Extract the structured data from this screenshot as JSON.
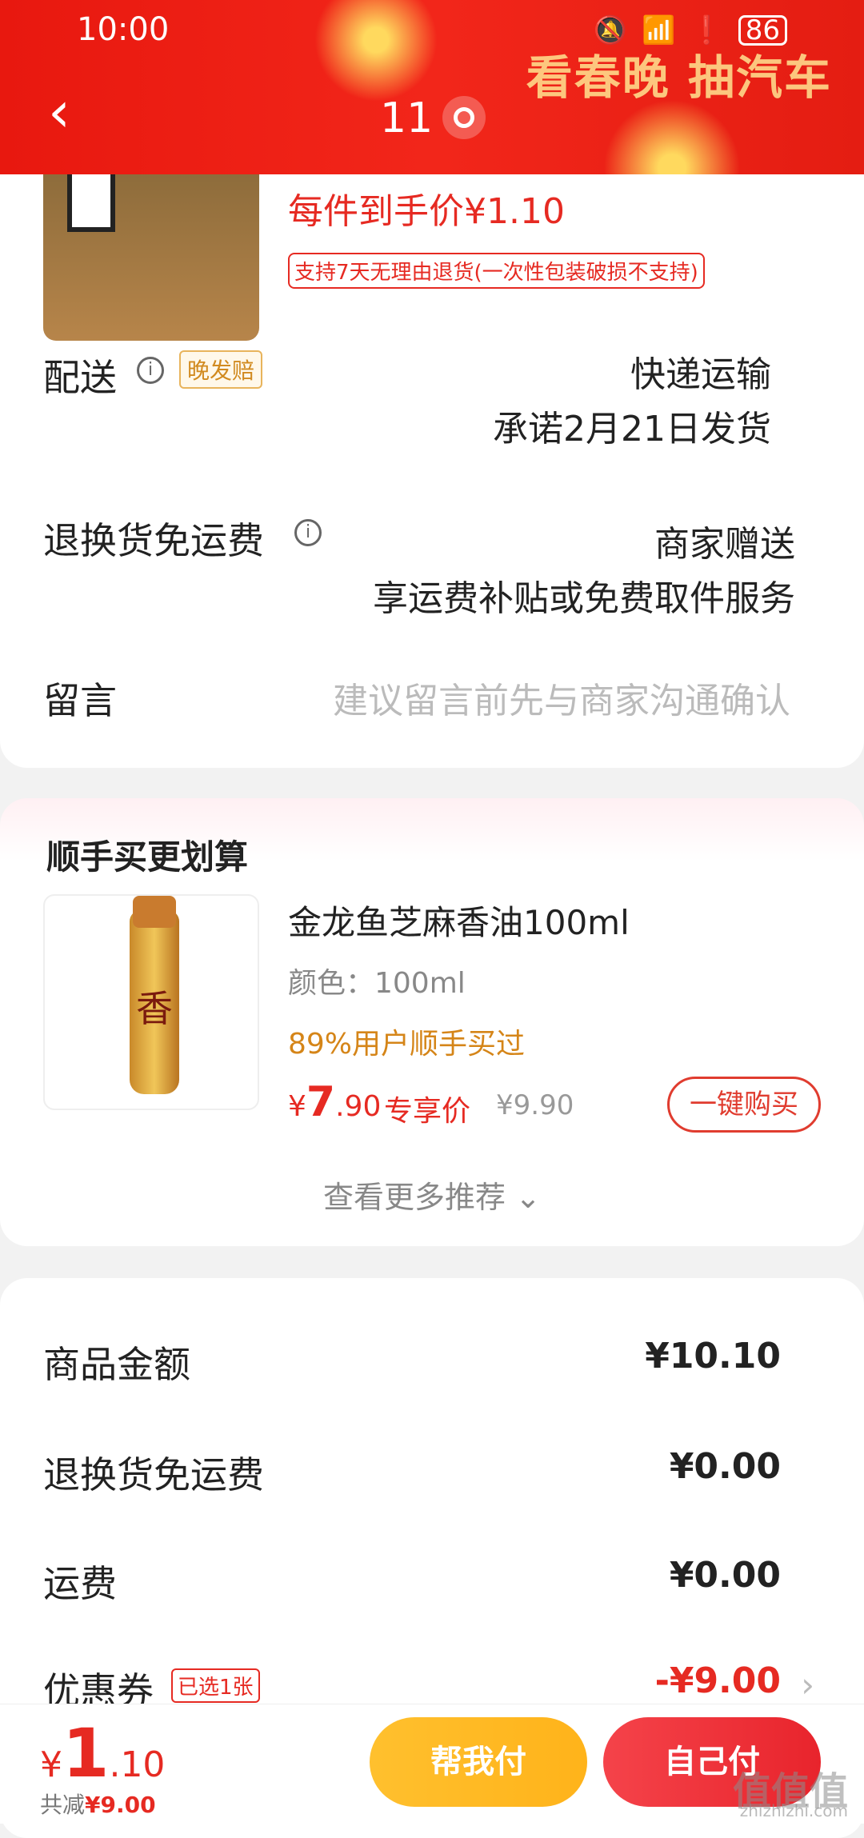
{
  "status_bar": {
    "time": "10:00",
    "battery": "86"
  },
  "header": {
    "title": "11",
    "banner": "看春晚 抽汽车"
  },
  "product": {
    "price_line": "每件到手价¥1.10",
    "return_policy": "支持7天无理由退货(一次性包装破损不支持)"
  },
  "delivery": {
    "label": "配送",
    "tag": "晚发赔",
    "method": "快递运输",
    "promise": "承诺2月21日发货"
  },
  "return_shipping": {
    "label": "退换货免运费",
    "value1": "商家赠送",
    "value2": "享运费补贴或免费取件服务"
  },
  "message": {
    "label": "留言",
    "placeholder": "建议留言前先与商家沟通确认"
  },
  "recommend": {
    "title": "顺手买更划算",
    "name": "金龙鱼芝麻香油100ml",
    "spec": "颜色：100ml",
    "buyers": "89%用户顺手买过",
    "price_symbol": "¥",
    "price_int": "7",
    "price_dec": ".90",
    "exclusive": "专享价",
    "original": "¥9.90",
    "buy_label": "一键购买",
    "img_char": "香",
    "more_label": "查看更多推荐 ⌄"
  },
  "summary": {
    "goods_label": "商品金额",
    "goods_value": "¥10.10",
    "return_label": "退换货免运费",
    "return_value": "¥0.00",
    "freight_label": "运费",
    "freight_value": "¥0.00",
    "coupon_label": "优惠券",
    "coupon_tag": "已选1张",
    "coupon_value": "-¥9.00"
  },
  "bottom": {
    "symbol": "¥",
    "total_int": "1",
    "total_dec": ".10",
    "saved_label": "共减",
    "saved_value": "¥9.00",
    "friend_pay": "帮我付",
    "self_pay": "自己付"
  },
  "watermark": {
    "text": "值值值",
    "sub": "zhizhizhi.com"
  }
}
